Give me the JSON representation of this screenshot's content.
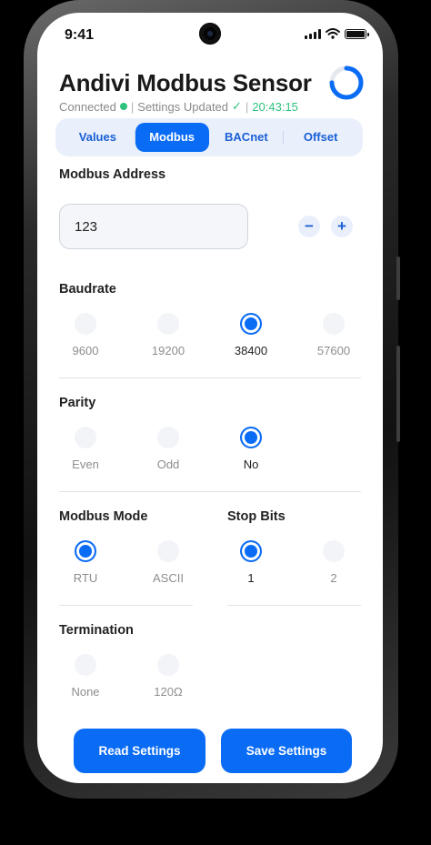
{
  "status_bar": {
    "time": "9:41"
  },
  "header": {
    "title": "Andivi Modbus Sensor",
    "connection": "Connected",
    "settings_status": "Settings Updated",
    "timestamp": "20:43:15",
    "sync_progress": 0.75
  },
  "tabs": [
    {
      "label": "Values",
      "active": false
    },
    {
      "label": "Modbus",
      "active": true
    },
    {
      "label": "BACnet",
      "active": false
    },
    {
      "label": "Offset",
      "active": false
    }
  ],
  "modbus_address": {
    "label": "Modbus Address",
    "value": "123",
    "decrement": "−",
    "increment": "+"
  },
  "baudrate": {
    "label": "Baudrate",
    "options": [
      "9600",
      "19200",
      "38400",
      "57600"
    ],
    "selected": "38400"
  },
  "parity": {
    "label": "Parity",
    "options": [
      "Even",
      "Odd",
      "No"
    ],
    "selected": "No"
  },
  "modbus_mode": {
    "label": "Modbus Mode",
    "options": [
      "RTU",
      "ASCII"
    ],
    "selected": "RTU"
  },
  "stop_bits": {
    "label": "Stop Bits",
    "options": [
      "1",
      "2"
    ],
    "selected": "1"
  },
  "termination": {
    "label": "Termination",
    "options": [
      "None",
      "120Ω"
    ],
    "selected": ""
  },
  "buttons": {
    "read": "Read Settings",
    "save": "Save Settings"
  },
  "colors": {
    "accent": "#0a6cf5",
    "success": "#2ec27e",
    "tab_bg": "#e9f0fb"
  }
}
